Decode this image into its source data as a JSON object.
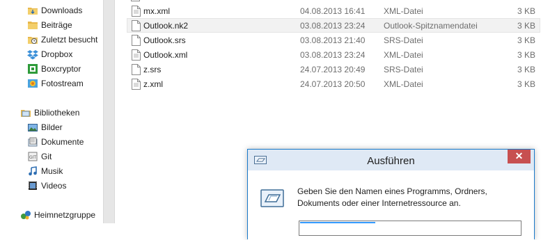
{
  "nav": {
    "favorites": [
      {
        "label": "Downloads",
        "icon": "downloads-folder-icon"
      },
      {
        "label": "Beiträge",
        "icon": "folder-icon"
      },
      {
        "label": "Zuletzt besucht",
        "icon": "recent-places-icon"
      },
      {
        "label": "Dropbox",
        "icon": "dropbox-icon"
      },
      {
        "label": "Boxcryptor",
        "icon": "boxcryptor-icon"
      },
      {
        "label": "Fotostream",
        "icon": "photostream-icon"
      }
    ],
    "libraries_header": "Bibliotheken",
    "libraries": [
      {
        "label": "Bilder",
        "icon": "pictures-library-icon"
      },
      {
        "label": "Dokumente",
        "icon": "documents-library-icon"
      },
      {
        "label": "Git",
        "icon": "git-library-icon"
      },
      {
        "label": "Musik",
        "icon": "music-library-icon"
      },
      {
        "label": "Videos",
        "icon": "videos-library-icon"
      }
    ],
    "homegroup": "Heimnetzgruppe"
  },
  "files": [
    {
      "name": "mx.xml",
      "date": "04.08.2013 16:41",
      "type": "XML-Datei",
      "size": "3 KB"
    },
    {
      "name": "Outlook.nk2",
      "date": "03.08.2013 23:24",
      "type": "Outlook-Spitznamendatei",
      "size": "3 KB"
    },
    {
      "name": "Outlook.srs",
      "date": "03.08.2013 21:40",
      "type": "SRS-Datei",
      "size": "3 KB"
    },
    {
      "name": "Outlook.xml",
      "date": "03.08.2013 23:24",
      "type": "XML-Datei",
      "size": "3 KB"
    },
    {
      "name": "z.srs",
      "date": "24.07.2013 20:49",
      "type": "SRS-Datei",
      "size": "3 KB"
    },
    {
      "name": "z.xml",
      "date": "24.07.2013 20:50",
      "type": "XML-Datei",
      "size": "3 KB"
    }
  ],
  "selected_file": "Outlook.nk2",
  "dialog": {
    "title": "Ausführen",
    "close_glyph": "✕",
    "prompt": "Geben Sie den Namen eines Programms, Ordners, Dokuments oder einer Internetressource an.",
    "input_value": ""
  },
  "colors": {
    "accent": "#1979ca",
    "close": "#c75050",
    "titlebar": "#dfe9f5",
    "selected_row": "#f2f2f2"
  }
}
